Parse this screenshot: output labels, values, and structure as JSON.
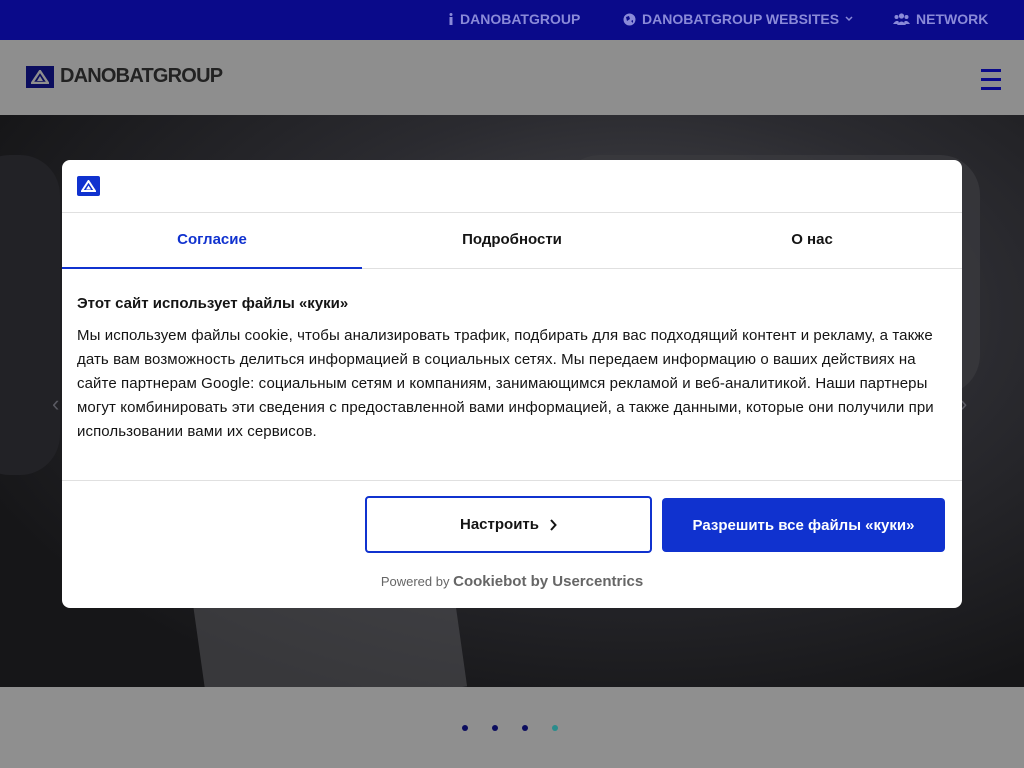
{
  "topbar": {
    "links": [
      {
        "label": "DANOBATGROUP",
        "icon": "info-icon"
      },
      {
        "label": "DANOBATGROUP WEBSITES",
        "icon": "globe-icon"
      },
      {
        "label": "NETWORK",
        "icon": "users-icon"
      }
    ]
  },
  "header": {
    "logo_text": "DANOBATGROUP"
  },
  "hero": {
    "slides_total": 4,
    "active_slide": 4
  },
  "dialog": {
    "tabs": [
      {
        "label": "Согласие",
        "active": true
      },
      {
        "label": "Подробности",
        "active": false
      },
      {
        "label": "О нас",
        "active": false
      }
    ],
    "title": "Этот сайт использует файлы «куки»",
    "text": "Мы используем файлы cookie, чтобы анализировать трафик, подбирать для вас подходящий контент и рекламу, а также дать вам возможность делиться информацией в социальных сетях. Мы передаем информацию о ваших действиях на сайте партнерам Google: социальным сетям и компаниям, занимающимся рекламой и веб-аналитикой. Наши партнеры могут комбинировать эти сведения с предоставленной вами информацией, а также данными, которые они получили при использовании вами их сервисов.",
    "customize_label": "Настроить",
    "allow_label": "Разрешить все файлы «куки»",
    "powered_prefix": "Powered by",
    "powered_brand": "Cookiebot by Usercentrics"
  },
  "colors": {
    "topbar": "#0a0a8a",
    "accent": "#1032cf",
    "overlay_header": "#8e8e8e"
  }
}
